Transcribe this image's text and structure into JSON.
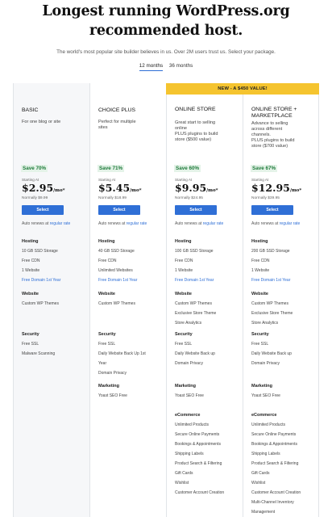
{
  "header": {
    "title": "Longest running WordPress.org recommended host.",
    "subtitle": "The world's most popular site builder believes in us. Over 2M users trust us. Select your package."
  },
  "term_tabs": [
    {
      "label": "12 months",
      "active": true
    },
    {
      "label": "36 months",
      "active": false
    }
  ],
  "banner": "NEW - A $450 VALUE!",
  "plans": [
    {
      "name": "BASIC",
      "desc": [
        "For one blog or site"
      ],
      "save": "Save 70%",
      "starting": "Starting At",
      "price": "$2.95",
      "per": "/mo*",
      "normally": "Normally $9.99",
      "select": "Select",
      "renew_prefix": "Auto renews at ",
      "renew_link": "regular rate",
      "sections": [
        {
          "title": "Hosting",
          "items": [
            {
              "text": "10 GB SSD Storage"
            },
            {
              "text": "Free CDN"
            },
            {
              "text": "1 Website"
            },
            {
              "text": "Free Domain 1st Year",
              "link": true
            }
          ]
        },
        {
          "title": "Website",
          "items": [
            {
              "text": "Custom WP Themes"
            }
          ]
        },
        {
          "title": "Security",
          "items": [
            {
              "text": "Free SSL"
            },
            {
              "text": "Malware Scanning"
            }
          ]
        }
      ]
    },
    {
      "name": "CHOICE PLUS",
      "desc": [
        "Perfect for multiple",
        "sites"
      ],
      "save": "Save 71%",
      "starting": "Starting At",
      "price": "$5.45",
      "per": "/mo*",
      "normally": "Normally $18.99",
      "select": "Select",
      "renew_prefix": "Auto renews at ",
      "renew_link": "regular rate",
      "sections": [
        {
          "title": "Hosting",
          "items": [
            {
              "text": "40 GB SSD Storage"
            },
            {
              "text": "Free CDN"
            },
            {
              "text": "Unlimited Websites"
            },
            {
              "text": "Free Domain 1st Year",
              "link": true
            }
          ]
        },
        {
          "title": "Website",
          "items": [
            {
              "text": "Custom WP Themes"
            }
          ]
        },
        {
          "title": "Security",
          "items": [
            {
              "text": "Free SSL"
            },
            {
              "text": "Daily Website Back Up 1st"
            },
            {
              "text": "Year"
            },
            {
              "text": "Domain Privacy"
            }
          ]
        },
        {
          "title": "Marketing",
          "items": [
            {
              "text": "Yoast SEO Free"
            }
          ]
        }
      ]
    },
    {
      "name": "ONLINE STORE",
      "desc": [
        "Great start to selling",
        "online",
        "PLUS plugins to build",
        "store ($500 value)"
      ],
      "save": "Save 60%",
      "starting": "Starting At",
      "price": "$9.95",
      "per": "/mo*",
      "normally": "Normally $24.95",
      "select": "Select",
      "renew_prefix": "Auto renews at ",
      "renew_link": "regular rate",
      "sections": [
        {
          "title": "Hosting",
          "items": [
            {
              "text": "100 GB SSD Storage"
            },
            {
              "text": "Free CDN"
            },
            {
              "text": "1 Website"
            },
            {
              "text": "Free Domain 1st Year",
              "link": true
            }
          ]
        },
        {
          "title": "Website",
          "items": [
            {
              "text": "Custom WP Themes"
            },
            {
              "text": "Exclusive Store Theme"
            },
            {
              "text": "Store Analytics"
            }
          ]
        },
        {
          "title": "Security",
          "items": [
            {
              "text": "Free SSL"
            },
            {
              "text": "Daily Website Back up"
            },
            {
              "text": "Domain Privacy"
            }
          ]
        },
        {
          "title": "Marketing",
          "items": [
            {
              "text": "Yoast SEO Free"
            }
          ]
        },
        {
          "title": "eCommerce",
          "items": [
            {
              "text": "Unlimited Products"
            },
            {
              "text": "Secure Online Payments"
            },
            {
              "text": "Bookings & Appointments"
            },
            {
              "text": "Shipping Labels"
            },
            {
              "text": "Product Search & Filtering"
            },
            {
              "text": "Gift Cards"
            },
            {
              "text": "Wishlist"
            },
            {
              "text": "Customer Account Creation"
            }
          ]
        }
      ]
    },
    {
      "name": "ONLINE STORE + MARKETPLACE",
      "desc": [
        "Advance to selling",
        "across different",
        "channels.",
        "PLUS plugins to build",
        "store ($700 value)"
      ],
      "save": "Save 67%",
      "starting": "Starting At",
      "price": "$12.95",
      "per": "/mo*",
      "normally": "Normally $39.95",
      "select": "Select",
      "renew_prefix": "Auto renews at ",
      "renew_link": "regular rate",
      "sections": [
        {
          "title": "Hosting",
          "items": [
            {
              "text": "200 GB SSD Storage"
            },
            {
              "text": "Free CDN"
            },
            {
              "text": "1 Website"
            },
            {
              "text": "Free Domain 1st Year",
              "link": true
            }
          ]
        },
        {
          "title": "Website",
          "items": [
            {
              "text": "Custom WP Themes"
            },
            {
              "text": "Exclusive Store Theme"
            },
            {
              "text": "Store Analytics"
            }
          ]
        },
        {
          "title": "Security",
          "items": [
            {
              "text": "Free SSL"
            },
            {
              "text": "Daily Website Back up"
            },
            {
              "text": "Domain Privacy"
            }
          ]
        },
        {
          "title": "Marketing",
          "items": [
            {
              "text": "Yoast SEO Free"
            }
          ]
        },
        {
          "title": "eCommerce",
          "items": [
            {
              "text": "Unlimited Products"
            },
            {
              "text": "Secure Online Payments"
            },
            {
              "text": "Bookings & Appointments"
            },
            {
              "text": "Shipping Labels"
            },
            {
              "text": "Product Search & Filtering"
            },
            {
              "text": "Gift Cards"
            },
            {
              "text": "Wishlist"
            },
            {
              "text": "Customer Account Creation"
            },
            {
              "text": "Multi-Channel Inventory"
            },
            {
              "text": "Management"
            }
          ]
        }
      ]
    }
  ]
}
